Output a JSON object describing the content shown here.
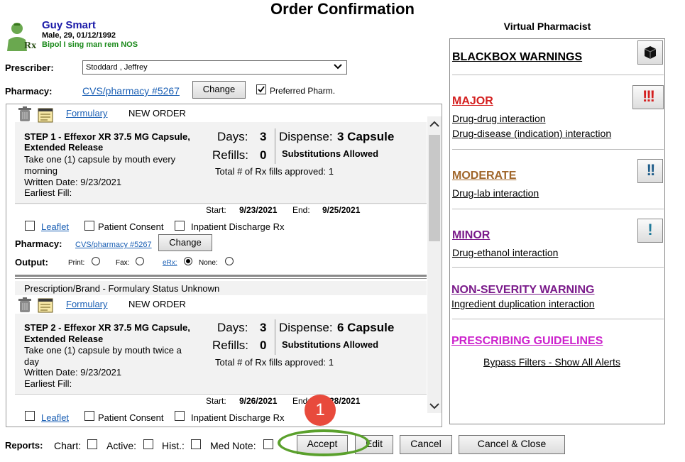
{
  "window": {
    "title": "Order Confirmation"
  },
  "patient": {
    "name": "Guy Smart",
    "info": "Male, 29, 01/12/1992",
    "diagnosis": "Bipol I sing man rem NOS"
  },
  "prescriber": {
    "label": "Prescriber:",
    "value": "Stoddard , Jeffrey"
  },
  "pharmacy": {
    "label": "Pharmacy:",
    "value": "CVS/pharmacy #5267",
    "change_label": "Change",
    "preferred_label": "Preferred Pharm.",
    "preferred_checked": true
  },
  "orders": [
    {
      "formulary_label": "Formulary",
      "status": "NEW ORDER",
      "drug": "STEP 1 - Effexor XR 37.5 MG Capsule, Extended Release",
      "drug_line1": "STEP 1 - Effexor XR 37.5 MG Capsule,",
      "drug_line2": "Extended Release",
      "sig_line1": "Take one (1) capsule by mouth every",
      "sig_line2": "morning",
      "written": "Written Date: 9/23/2021",
      "earliest": "Earliest Fill:",
      "days_label": "Days:",
      "days": "3",
      "refills_label": "Refills:",
      "refills": "0",
      "dispense_label": "Dispense:",
      "dispense": "3 Capsule",
      "substitution": "Substitutions Allowed",
      "total_fills": "Total # of Rx fills approved: 1",
      "start_label": "Start:",
      "start": "9/23/2021",
      "end_label": "End:",
      "end": "9/25/2021",
      "leaflet": "Leaflet",
      "consent": "Patient Consent",
      "discharge": "Inpatient Discharge Rx",
      "pharmacy_label": "Pharmacy:",
      "pharmacy": "CVS/pharmacy #5267",
      "change_label": "Change",
      "output_label": "Output:",
      "output_options": [
        "Print:",
        "Fax:",
        "eRx:",
        "None:"
      ],
      "output_selected": "eRx:"
    },
    {
      "header": "Prescription/Brand - Formulary Status Unknown",
      "formulary_label": "Formulary",
      "status": "NEW ORDER",
      "drug_line1": "STEP 2 - Effexor XR 37.5 MG Capsule,",
      "drug_line2": "Extended Release",
      "sig_line1": "Take one (1) capsule by mouth twice a",
      "sig_line2": "day",
      "written": "Written Date: 9/23/2021",
      "earliest": "Earliest Fill:",
      "days_label": "Days:",
      "days": "3",
      "refills_label": "Refills:",
      "refills": "0",
      "dispense_label": "Dispense:",
      "dispense": "6 Capsule",
      "substitution": "Substitutions Allowed",
      "total_fills": "Total # of Rx fills approved: 1",
      "start_label": "Start:",
      "start": "9/26/2021",
      "end_label": "End:",
      "end": "9/28/2021",
      "leaflet": "Leaflet",
      "consent": "Patient Consent",
      "discharge": "Inpatient Discharge Rx"
    }
  ],
  "virtual_pharmacist": {
    "title": "Virtual Pharmacist",
    "blackbox": {
      "label": "BLACKBOX WARNINGS",
      "color": "#000000"
    },
    "major": {
      "label": "MAJOR",
      "color": "#d42020",
      "items": [
        "Drug-drug interaction",
        "Drug-disease (indication) interaction"
      ]
    },
    "moderate": {
      "label": "MODERATE",
      "color": "#a0662a",
      "items": [
        "Drug-lab interaction"
      ]
    },
    "minor": {
      "label": "MINOR",
      "color": "#7a1a8a",
      "items": [
        "Drug-ethanol interaction"
      ]
    },
    "nonseverity": {
      "label": "NON-SEVERITY WARNING",
      "color": "#7a1a8a",
      "items": [
        "Ingredient duplication interaction"
      ]
    },
    "guidelines": {
      "label": "PRESCRIBING GUIDELINES",
      "color": "#cc22cc"
    },
    "bypass": "Bypass Filters - Show All Alerts"
  },
  "reports": {
    "label": "Reports:",
    "chart": "Chart:",
    "active": "Active:",
    "hist": "Hist.:",
    "mednote": "Med Note:"
  },
  "buttons": {
    "accept": "Accept",
    "edit": "Edit",
    "cancel": "Cancel",
    "cancel_close": "Cancel & Close"
  },
  "annotation": {
    "badge": "1",
    "highlight_color": "#5aa02c",
    "badge_color": "#e84a3c"
  }
}
